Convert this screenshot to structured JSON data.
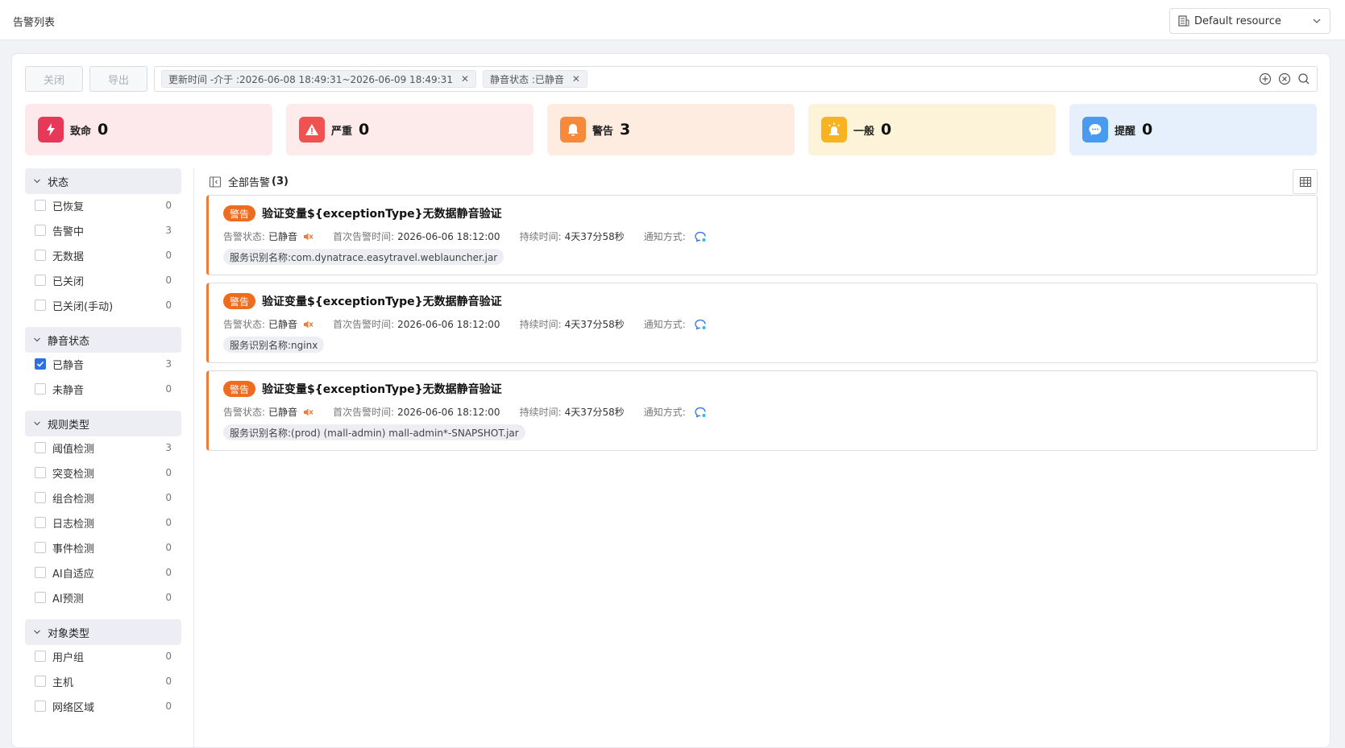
{
  "header": {
    "title": "告警列表",
    "resource_label": "Default resource"
  },
  "toolbar": {
    "close_label": "关闭",
    "export_label": "导出"
  },
  "filters": [
    {
      "label": "更新时间 -介于 :2026-06-08 18:49:31~2026-06-09 18:49:31"
    },
    {
      "label": "静音状态 :已静音"
    }
  ],
  "severity_cards": [
    {
      "name": "critical",
      "label": "致命",
      "count": "0",
      "bg": "#fde8ec",
      "icon_bg": "#e8385a"
    },
    {
      "name": "major",
      "label": "严重",
      "count": "0",
      "bg": "#fdeaea",
      "icon_bg": "#f05252"
    },
    {
      "name": "warning",
      "label": "警告",
      "count": "3",
      "bg": "#fdecdf",
      "icon_bg": "#f7893a"
    },
    {
      "name": "minor",
      "label": "一般",
      "count": "0",
      "bg": "#fdf3d9",
      "icon_bg": "#f7b322"
    },
    {
      "name": "info",
      "label": "提醒",
      "count": "0",
      "bg": "#e6f0fc",
      "icon_bg": "#4a9af0"
    }
  ],
  "sidebar": {
    "groups": [
      {
        "title": "状态",
        "items": [
          {
            "label": "已恢复",
            "count": "0",
            "checked": false
          },
          {
            "label": "告警中",
            "count": "3",
            "checked": false
          },
          {
            "label": "无数据",
            "count": "0",
            "checked": false
          },
          {
            "label": "已关闭",
            "count": "0",
            "checked": false
          },
          {
            "label": "已关闭(手动)",
            "count": "0",
            "checked": false
          }
        ]
      },
      {
        "title": "静音状态",
        "items": [
          {
            "label": "已静音",
            "count": "3",
            "checked": true
          },
          {
            "label": "未静音",
            "count": "0",
            "checked": false
          }
        ]
      },
      {
        "title": "规则类型",
        "items": [
          {
            "label": "阈值检测",
            "count": "3",
            "checked": false
          },
          {
            "label": "突变检测",
            "count": "0",
            "checked": false
          },
          {
            "label": "组合检测",
            "count": "0",
            "checked": false
          },
          {
            "label": "日志检测",
            "count": "0",
            "checked": false
          },
          {
            "label": "事件检测",
            "count": "0",
            "checked": false
          },
          {
            "label": "AI自适应",
            "count": "0",
            "checked": false
          },
          {
            "label": "AI预测",
            "count": "0",
            "checked": false
          }
        ]
      },
      {
        "title": "对象类型",
        "items": [
          {
            "label": "用户组",
            "count": "0",
            "checked": false
          },
          {
            "label": "主机",
            "count": "0",
            "checked": false
          },
          {
            "label": "网络区域",
            "count": "0",
            "checked": false
          }
        ]
      }
    ]
  },
  "list": {
    "header_label": "全部告警",
    "header_count": "(3)",
    "alerts": [
      {
        "level": "警告",
        "title": "验证变量${exceptionType}无数据静音验证",
        "status_label": "告警状态:",
        "status_value": "已静音",
        "first_time_label": "首次告警时间:",
        "first_time_value": "2026-06-06 18:12:00",
        "duration_label": "持续时间:",
        "duration_value": "4天37分58秒",
        "notify_label": "通知方式:",
        "service": "服务识别名称:com.dynatrace.easytravel.weblauncher.jar"
      },
      {
        "level": "警告",
        "title": "验证变量${exceptionType}无数据静音验证",
        "status_label": "告警状态:",
        "status_value": "已静音",
        "first_time_label": "首次告警时间:",
        "first_time_value": "2026-06-06 18:12:00",
        "duration_label": "持续时间:",
        "duration_value": "4天37分58秒",
        "notify_label": "通知方式:",
        "service": "服务识别名称:nginx"
      },
      {
        "level": "警告",
        "title": "验证变量${exceptionType}无数据静音验证",
        "status_label": "告警状态:",
        "status_value": "已静音",
        "first_time_label": "首次告警时间:",
        "first_time_value": "2026-06-06 18:12:00",
        "duration_label": "持续时间:",
        "duration_value": "4天37分58秒",
        "notify_label": "通知方式:",
        "service": "服务识别名称:(prod) (mall-admin) mall-admin*-SNAPSHOT.jar"
      }
    ]
  }
}
